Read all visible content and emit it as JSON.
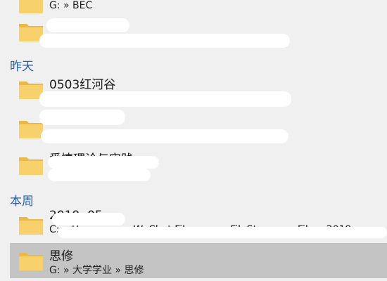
{
  "groups": {
    "yesterday": "昨天",
    "this_week": "本周"
  },
  "items": [
    {
      "title": "",
      "path": "G: » BEC"
    },
    {
      "title": "",
      "path": ""
    },
    {
      "title": "0503红河谷",
      "path": ""
    },
    {
      "title": "",
      "path": ""
    },
    {
      "title": "爱情理论与实践",
      "path": ""
    },
    {
      "title": "2019. 05",
      "path": "C: » Users » ... » WeChat Files » ... » FileStorage » File » 2019"
    },
    {
      "title": "思修",
      "path": "G: » 大学学业 » 思修"
    }
  ],
  "colors": {
    "background": "#f0f0f0",
    "selected": "#c4c4c4",
    "group_header": "#2a5ea8",
    "folder": "#f7d26c"
  },
  "icons": {
    "folder": "folder-icon"
  }
}
